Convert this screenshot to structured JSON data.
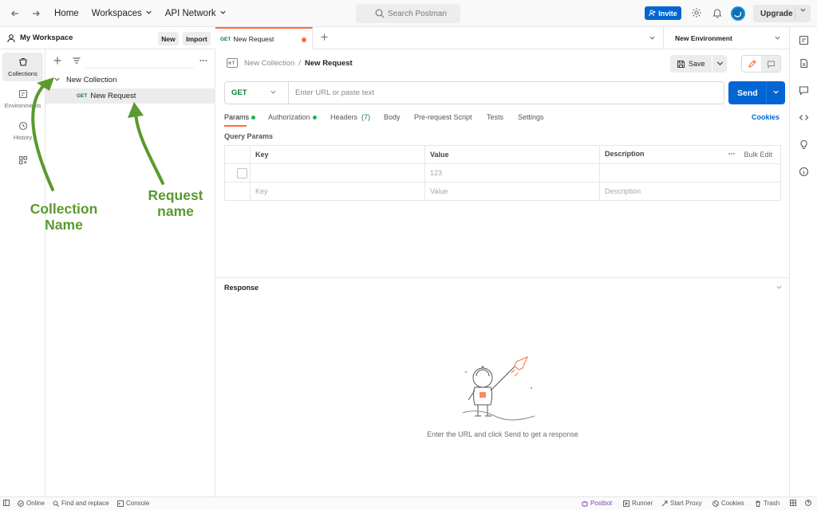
{
  "topbar": {
    "home": "Home",
    "workspaces": "Workspaces",
    "api_network": "API Network",
    "search_placeholder": "Search Postman",
    "invite": "Invite",
    "upgrade": "Upgrade"
  },
  "workspace": {
    "name": "My Workspace",
    "new_button": "New",
    "import_button": "Import"
  },
  "rail": {
    "items": [
      {
        "label": "Collections",
        "icon": "collections-icon"
      },
      {
        "label": "Environments",
        "icon": "environments-icon"
      },
      {
        "label": "History",
        "icon": "history-icon"
      },
      {
        "label": "",
        "icon": "apps-icon"
      }
    ]
  },
  "tree": {
    "collection": "New Collection",
    "request_method": "GET",
    "request_name": "New Request"
  },
  "tabs": {
    "active_method": "GET",
    "active_label": "New Request",
    "environment": "New Environment"
  },
  "request": {
    "collection": "New Collection",
    "separator": "/",
    "name": "New Request",
    "save": "Save",
    "method": "GET",
    "url_placeholder": "Enter URL or paste text",
    "send": "Send",
    "tabs": [
      "Params",
      "Authorization",
      "Headers",
      "Body",
      "Pre-request Script",
      "Tests",
      "Settings"
    ],
    "headers_count": "(7)",
    "cookies": "Cookies",
    "query_params_label": "Query Params",
    "table": {
      "headers": [
        "Key",
        "Value",
        "Description"
      ],
      "bulk_edit": "Bulk Edit",
      "row1_value": "123",
      "placeholder_key": "Key",
      "placeholder_value": "Value",
      "placeholder_description": "Description"
    }
  },
  "response": {
    "title": "Response",
    "empty_message": "Enter the URL and click Send to get a response"
  },
  "annotations": {
    "collection_name": "Collection Name",
    "request_name_line1": "Request",
    "request_name_line2": "name"
  },
  "statusbar": {
    "online": "Online",
    "find_replace": "Find and replace",
    "console": "Console",
    "postbot": "Postbot",
    "runner": "Runner",
    "start_proxy": "Start Proxy",
    "cookies": "Cookies",
    "trash": "Trash"
  },
  "colors": {
    "accent_orange": "#ff6c37",
    "primary_blue": "#0265d2",
    "get_green": "#0f7b3e",
    "annotation_green": "#5a9a2e"
  }
}
